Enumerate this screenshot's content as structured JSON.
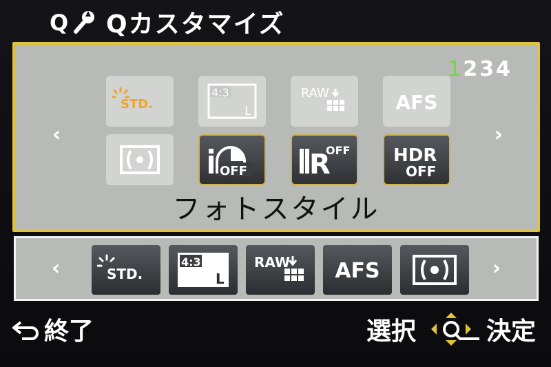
{
  "header": {
    "title": "Qカスタマイズ",
    "icon": "q-wrench-icon"
  },
  "main": {
    "page_indicator": {
      "current": "1",
      "rest": "234"
    },
    "function_label": "フォトスタイル",
    "tiles": [
      {
        "id": "photo-style",
        "icon": "photo-style-std-icon",
        "text": "STD.",
        "state": "faded"
      },
      {
        "id": "aspect-size",
        "icon": "aspect-ratio-icon",
        "ratio": "4:3",
        "size": "L",
        "state": "faded"
      },
      {
        "id": "quality",
        "icon": "raw-quality-icon",
        "text": "RAW",
        "state": "faded"
      },
      {
        "id": "focus-mode",
        "icon": "focus-mode-icon",
        "text": "AFS",
        "state": "faded"
      },
      {
        "id": "metering",
        "icon": "metering-icon",
        "state": "faded"
      },
      {
        "id": "i-dynamic",
        "icon": "i-dynamic-off-icon",
        "text": "OFF",
        "state": "selected"
      },
      {
        "id": "i-resolution",
        "icon": "i-resolution-off-icon",
        "text": "OFF",
        "state": "selected"
      },
      {
        "id": "hdr",
        "icon": "hdr-off-icon",
        "text": "HDR",
        "sub": "OFF",
        "state": "selected"
      }
    ]
  },
  "strip": {
    "items": [
      {
        "id": "photo-style",
        "icon": "photo-style-std-icon",
        "text": "STD."
      },
      {
        "id": "aspect-size",
        "icon": "aspect-ratio-icon",
        "ratio": "4:3",
        "size": "L"
      },
      {
        "id": "quality",
        "icon": "raw-quality-icon",
        "text": "RAW"
      },
      {
        "id": "focus-mode",
        "icon": "focus-mode-icon",
        "text": "AFS"
      },
      {
        "id": "metering",
        "icon": "metering-icon"
      }
    ]
  },
  "footer": {
    "back_label": "終了",
    "select_label": "選択",
    "confirm_label": "決定",
    "back_icon": "return-arrow-icon",
    "dpad_icon": "dpad-icon"
  },
  "colors": {
    "accent": "#e0c33d",
    "page_current": "#7bd04b",
    "panel": "#b7bab6",
    "sun": "#f0a328"
  }
}
